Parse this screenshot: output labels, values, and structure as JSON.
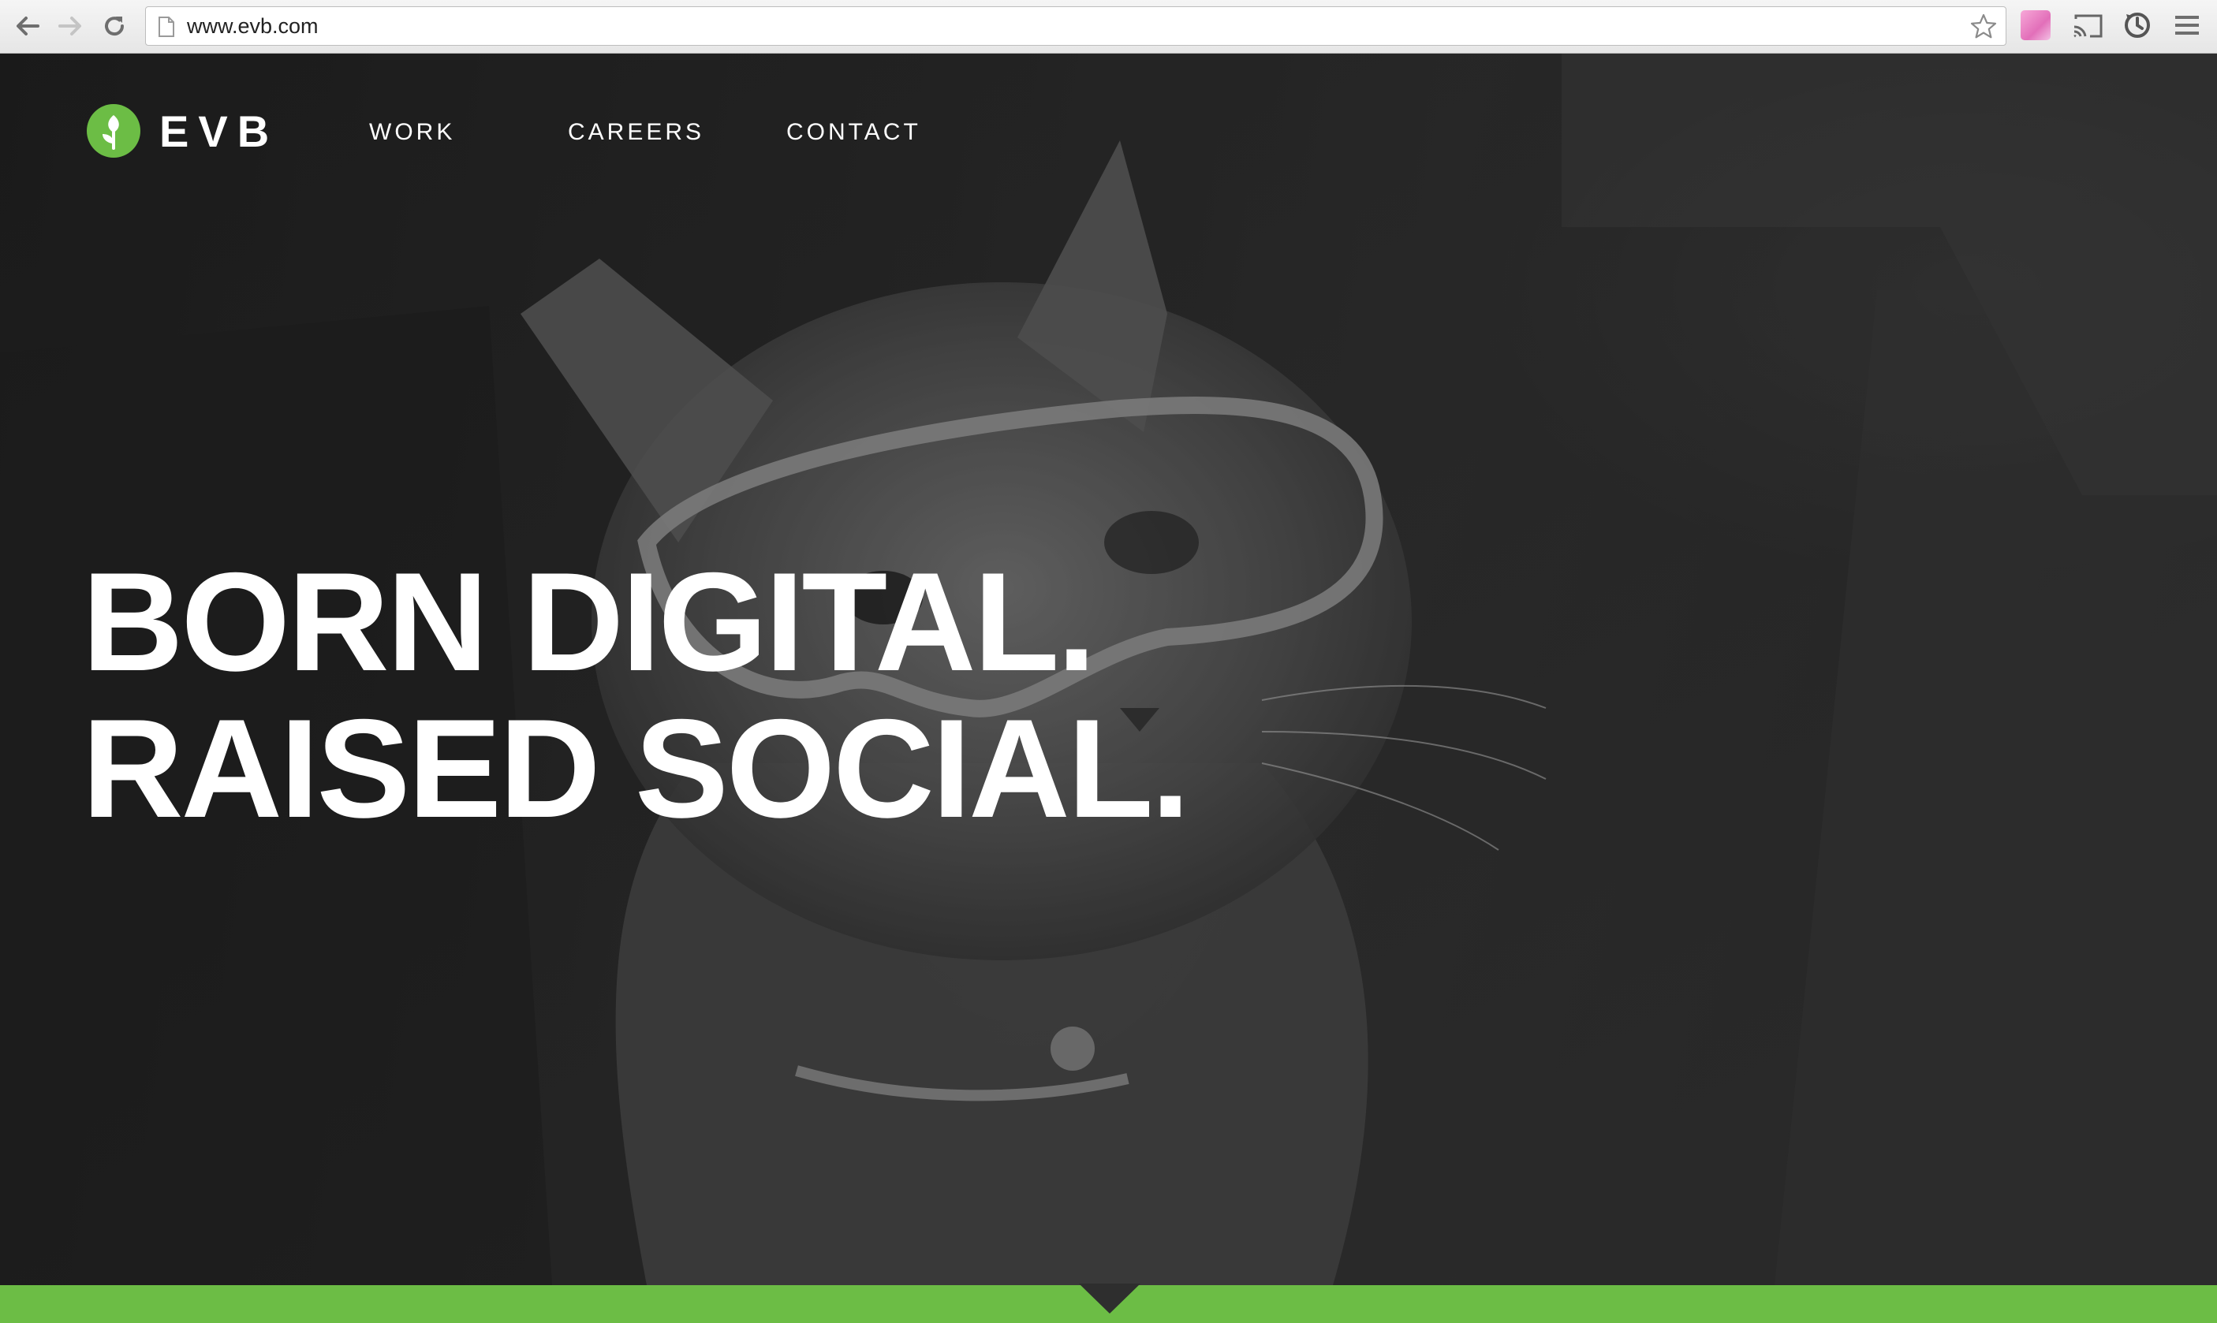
{
  "browser": {
    "url": "www.evb.com",
    "icons": {
      "back": "arrow-left-icon",
      "forward": "arrow-right-icon",
      "reload": "reload-icon",
      "page": "page-icon",
      "bookmark": "star-icon",
      "extension": "extension-icon",
      "cast": "cast-icon",
      "sync": "sync-icon",
      "menu": "hamburger-menu-icon"
    }
  },
  "site": {
    "brand": {
      "logo_icon": "leaf-logo-icon",
      "name": "EVB",
      "brand_color": "#6cbd45"
    },
    "nav": [
      {
        "label": "WORK"
      },
      {
        "label": "CAREERS"
      },
      {
        "label": "CONTACT"
      }
    ],
    "hero": {
      "headline_line1": "BORN DIGITAL.",
      "headline_line2": "RAISED SOCIAL.",
      "image": "grayscale cat wearing goggles"
    },
    "footer_bar": {
      "color": "#6cbd45",
      "arrow_icon": "scroll-down-notch-icon"
    }
  }
}
